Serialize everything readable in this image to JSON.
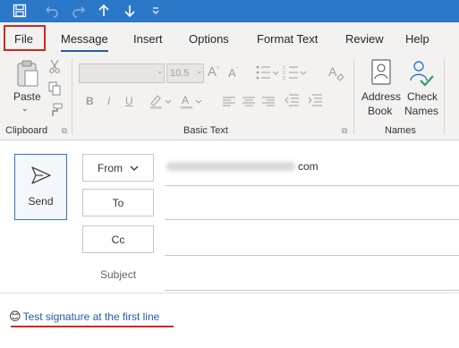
{
  "quick_access": {
    "icons": [
      "save-icon",
      "undo-icon",
      "redo-icon",
      "arrow-up-icon",
      "arrow-down-icon",
      "customize-icon"
    ]
  },
  "tabs": [
    {
      "label": "File"
    },
    {
      "label": "Message"
    },
    {
      "label": "Insert"
    },
    {
      "label": "Options"
    },
    {
      "label": "Format Text"
    },
    {
      "label": "Review"
    },
    {
      "label": "Help"
    }
  ],
  "ribbon": {
    "clipboard": {
      "paste_label": "Paste",
      "group_label": "Clipboard"
    },
    "basic_text": {
      "font_size": "10.5",
      "group_label": "Basic Text"
    },
    "names": {
      "address_book_line1": "Address",
      "address_book_line2": "Book",
      "check_names_line1": "Check",
      "check_names_line2": "Names",
      "group_label": "Names"
    }
  },
  "compose": {
    "send_label": "Send",
    "from_label": "From",
    "from_address_tail": "com",
    "to_label": "To",
    "cc_label": "Cc",
    "subject_label": "Subject",
    "signature_emoji": "😊",
    "signature_text": "Test signature at the first line"
  },
  "colors": {
    "title_bar": "#2b78c9",
    "ribbon_bg": "#f3f2f1",
    "accent": "#1f5ea8",
    "highlight_red": "#d0281e"
  }
}
